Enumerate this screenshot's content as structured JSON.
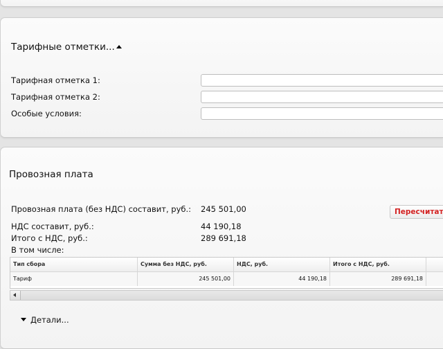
{
  "tariff_section": {
    "title": "Тарифные отметки...",
    "fields": [
      {
        "label": "Тарифная отметка 1:",
        "value": ""
      },
      {
        "label": "Тарифная отметка 2:",
        "value": ""
      },
      {
        "label": "Особые условия:",
        "value": ""
      }
    ]
  },
  "freight_section": {
    "title": "Провозная плата",
    "rows": [
      {
        "label": "Провозная плата (без НДС) составит, руб.:",
        "value": "245 501,00"
      },
      {
        "label": "НДС составит, руб.:",
        "value": "44 190,18"
      },
      {
        "label": "Итого с НДС, руб.:",
        "value": "289 691,18"
      }
    ],
    "including_label": "В том числе:",
    "recalc_label": "Пересчитать",
    "table": {
      "columns": [
        "Тип сбора",
        "Сумма без НДС, руб.",
        "НДС, руб.",
        "Итого с НДС, руб."
      ],
      "rows": [
        [
          "Тариф",
          "245 501,00",
          "44 190,18",
          "289 691,18"
        ]
      ]
    },
    "details_label": "Детали..."
  }
}
